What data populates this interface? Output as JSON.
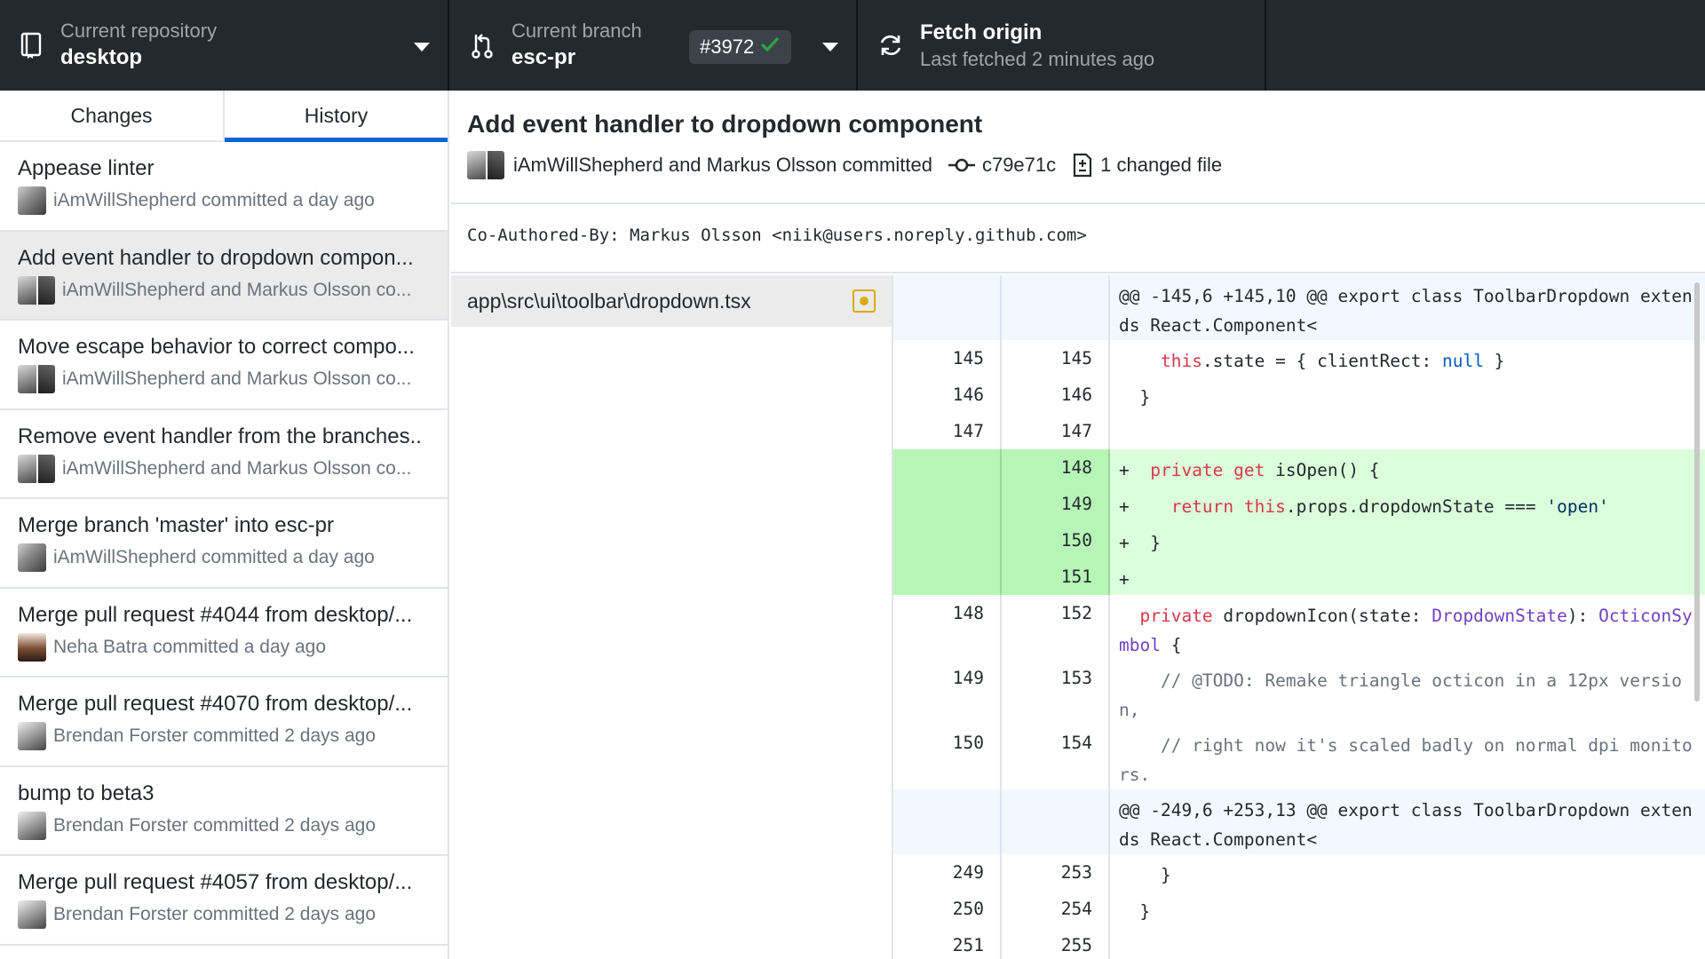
{
  "toolbar": {
    "repo_label": "Current repository",
    "repo_name": "desktop",
    "branch_label": "Current branch",
    "branch_name": "esc-pr",
    "pr_number": "#3972",
    "fetch_title": "Fetch origin",
    "fetch_status": "Last fetched 2 minutes ago"
  },
  "tabs": {
    "changes": "Changes",
    "history": "History"
  },
  "commits": [
    {
      "summary": "Appease linter",
      "author": "iAmWillShepherd committed a day ago",
      "avatar": "dark"
    },
    {
      "summary": "Add event handler to dropdown compon...",
      "author": "iAmWillShepherd and Markus Olsson co...",
      "avatar": "pair"
    },
    {
      "summary": "Move escape behavior to correct compo...",
      "author": "iAmWillShepherd and Markus Olsson co...",
      "avatar": "pair"
    },
    {
      "summary": "Remove event handler from the branches..",
      "author": "iAmWillShepherd and Markus Olsson co...",
      "avatar": "pair"
    },
    {
      "summary": "Merge branch 'master' into esc-pr",
      "author": "iAmWillShepherd committed a day ago",
      "avatar": "dark"
    },
    {
      "summary": "Merge pull request #4044 from desktop/...",
      "author": "Neha Batra committed a day ago",
      "avatar": "neha"
    },
    {
      "summary": "Merge pull request #4070 from desktop/...",
      "author": "Brendan Forster committed 2 days ago",
      "avatar": "brendan"
    },
    {
      "summary": "bump to beta3",
      "author": "Brendan Forster committed 2 days ago",
      "avatar": "brendan"
    },
    {
      "summary": "Merge pull request #4057 from desktop/...",
      "author": "Brendan Forster committed 2 days ago",
      "avatar": "brendan"
    }
  ],
  "commit_detail": {
    "title": "Add event handler to dropdown component",
    "authors": "iAmWillShepherd and Markus Olsson committed",
    "sha": "c79e71c",
    "changed_files": "1 changed file",
    "body": "Co-Authored-By: Markus Olsson <niik@users.noreply.github.com>"
  },
  "file_list": [
    {
      "path": "app\\src\\ui\\toolbar\\dropdown.tsx",
      "status": "modified"
    }
  ],
  "diff": [
    {
      "type": "hunk",
      "old": "",
      "new": "",
      "text": "@@ -145,6 +145,10 @@ export class ToolbarDropdown extends React.Component<"
    },
    {
      "type": "ctx",
      "old": "145",
      "new": "145",
      "text": "    this.state = { clientRect: null }"
    },
    {
      "type": "ctx",
      "old": "146",
      "new": "146",
      "text": "  }"
    },
    {
      "type": "ctx",
      "old": "147",
      "new": "147",
      "text": ""
    },
    {
      "type": "add",
      "old": "",
      "new": "148",
      "text": "+  private get isOpen() {"
    },
    {
      "type": "add",
      "old": "",
      "new": "149",
      "text": "+    return this.props.dropdownState === 'open'"
    },
    {
      "type": "add",
      "old": "",
      "new": "150",
      "text": "+  }"
    },
    {
      "type": "add",
      "old": "",
      "new": "151",
      "text": "+"
    },
    {
      "type": "ctx",
      "old": "148",
      "new": "152",
      "text": "  private dropdownIcon(state: DropdownState): OcticonSymbol {"
    },
    {
      "type": "ctx",
      "old": "149",
      "new": "153",
      "text": "    // @TODO: Remake triangle octicon in a 12px version,"
    },
    {
      "type": "ctx",
      "old": "150",
      "new": "154",
      "text": "    // right now it's scaled badly on normal dpi monitors."
    },
    {
      "type": "hunk",
      "old": "",
      "new": "",
      "text": "@@ -249,6 +253,13 @@ export class ToolbarDropdown extends React.Component<"
    },
    {
      "type": "ctx",
      "old": "249",
      "new": "253",
      "text": "    }"
    },
    {
      "type": "ctx",
      "old": "250",
      "new": "254",
      "text": "  }"
    },
    {
      "type": "ctx",
      "old": "251",
      "new": "255",
      "text": ""
    }
  ],
  "colors": {
    "toolbar_bg": "#24292e",
    "accent": "#0366d6",
    "added_bg": "#dbffdb",
    "hunk_bg": "#f1f8ff",
    "modified": "#dbab09",
    "success": "#28a745"
  }
}
